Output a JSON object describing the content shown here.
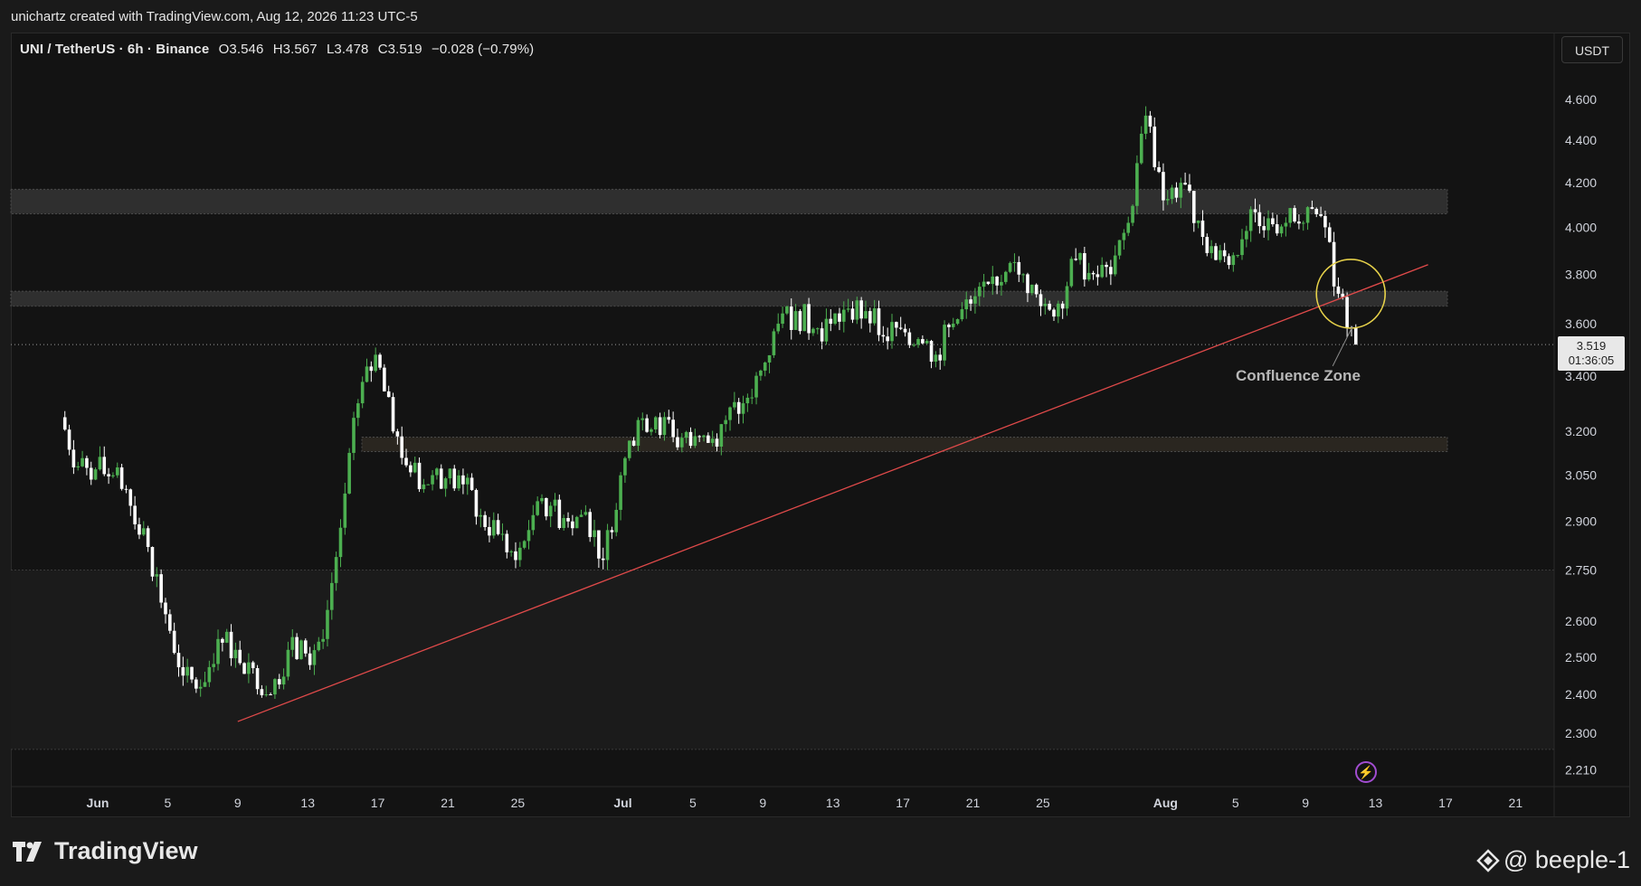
{
  "header": {
    "credit": "unichartz created with TradingView.com, Aug 12, 2026 11:23 UTC-5"
  },
  "legend": {
    "symbol": "UNI / TetherUS · 6h · Binance",
    "open": "O3.546",
    "high": "H3.567",
    "low": "L3.478",
    "close": "C3.519",
    "change": "−0.028 (−0.79%)"
  },
  "currency": "USDT",
  "last_price": {
    "price": "3.519",
    "countdown": "01:36:05"
  },
  "annotation": {
    "label": "Confluence Zone"
  },
  "footer": {
    "brand": "TradingView",
    "watermark": "@ beeple-1"
  },
  "colors": {
    "background": "#131313",
    "up": "#4caf50",
    "down": "#ffffff",
    "trendline": "#e04a4a",
    "zone": "#3a3a3a",
    "circle": "#e6d14a"
  },
  "chart_data": {
    "type": "candlestick",
    "title": "UNI / TetherUS · 6h · Binance",
    "y_axis": {
      "ticks": [
        "4.600",
        "4.400",
        "4.200",
        "4.000",
        "3.800",
        "3.600",
        "3.400",
        "3.200",
        "3.050",
        "2.900",
        "2.750",
        "2.600",
        "2.500",
        "2.400",
        "2.300",
        "2.210"
      ],
      "unit": "USDT",
      "scale": "log",
      "range": [
        2.17,
        4.95
      ]
    },
    "x_axis": {
      "ticks": [
        "Jun",
        "5",
        "9",
        "13",
        "17",
        "21",
        "25",
        "Jul",
        "5",
        "9",
        "13",
        "17",
        "21",
        "25",
        "Aug",
        "5",
        "9",
        "13",
        "17",
        "21"
      ]
    },
    "close_series": [
      {
        "x": "May 30",
        "y": 3.25
      },
      {
        "x": "May 31",
        "y": 3.08
      },
      {
        "x": "Jun 1",
        "y": 3.07
      },
      {
        "x": "Jun 2",
        "y": 3.05
      },
      {
        "x": "Jun 3",
        "y": 2.95
      },
      {
        "x": "Jun 4",
        "y": 2.82
      },
      {
        "x": "Jun 5",
        "y": 2.62
      },
      {
        "x": "Jun 6",
        "y": 2.45
      },
      {
        "x": "Jun 7",
        "y": 2.42
      },
      {
        "x": "Jun 8",
        "y": 2.55
      },
      {
        "x": "Jun 9",
        "y": 2.52
      },
      {
        "x": "Jun 10",
        "y": 2.47
      },
      {
        "x": "Jun 11",
        "y": 2.4
      },
      {
        "x": "Jun 12",
        "y": 2.52
      },
      {
        "x": "Jun 13",
        "y": 2.51
      },
      {
        "x": "Jun 14",
        "y": 2.55
      },
      {
        "x": "Jun 15",
        "y": 2.88
      },
      {
        "x": "Jun 16",
        "y": 3.3
      },
      {
        "x": "Jun 17",
        "y": 3.48
      },
      {
        "x": "Jun 18",
        "y": 3.2
      },
      {
        "x": "Jun 19",
        "y": 3.06
      },
      {
        "x": "Jun 20",
        "y": 3.02
      },
      {
        "x": "Jun 21",
        "y": 3.04
      },
      {
        "x": "Jun 22",
        "y": 3.02
      },
      {
        "x": "Jun 23",
        "y": 2.92
      },
      {
        "x": "Jun 24",
        "y": 2.86
      },
      {
        "x": "Jun 25",
        "y": 2.78
      },
      {
        "x": "Jun 26",
        "y": 2.92
      },
      {
        "x": "Jun 27",
        "y": 2.95
      },
      {
        "x": "Jun 28",
        "y": 2.9
      },
      {
        "x": "Jun 29",
        "y": 2.93
      },
      {
        "x": "Jun 30",
        "y": 2.78
      },
      {
        "x": "Jul 1",
        "y": 3.05
      },
      {
        "x": "Jul 2",
        "y": 3.24
      },
      {
        "x": "Jul 3",
        "y": 3.25
      },
      {
        "x": "Jul 4",
        "y": 3.18
      },
      {
        "x": "Jul 5",
        "y": 3.15
      },
      {
        "x": "Jul 6",
        "y": 3.16
      },
      {
        "x": "Jul 7",
        "y": 3.24
      },
      {
        "x": "Jul 8",
        "y": 3.3
      },
      {
        "x": "Jul 9",
        "y": 3.42
      },
      {
        "x": "Jul 10",
        "y": 3.6
      },
      {
        "x": "Jul 11",
        "y": 3.65
      },
      {
        "x": "Jul 12",
        "y": 3.58
      },
      {
        "x": "Jul 13",
        "y": 3.6
      },
      {
        "x": "Jul 14",
        "y": 3.66
      },
      {
        "x": "Jul 15",
        "y": 3.65
      },
      {
        "x": "Jul 16",
        "y": 3.55
      },
      {
        "x": "Jul 17",
        "y": 3.58
      },
      {
        "x": "Jul 18",
        "y": 3.54
      },
      {
        "x": "Jul 19",
        "y": 3.48
      },
      {
        "x": "Jul 20",
        "y": 3.6
      },
      {
        "x": "Jul 21",
        "y": 3.68
      },
      {
        "x": "Jul 22",
        "y": 3.76
      },
      {
        "x": "Jul 23",
        "y": 3.81
      },
      {
        "x": "Jul 24",
        "y": 3.8
      },
      {
        "x": "Jul 25",
        "y": 3.67
      },
      {
        "x": "Jul 26",
        "y": 3.68
      },
      {
        "x": "Jul 27",
        "y": 3.86
      },
      {
        "x": "Jul 28",
        "y": 3.8
      },
      {
        "x": "Jul 29",
        "y": 3.8
      },
      {
        "x": "Jul 30",
        "y": 4.02
      },
      {
        "x": "Jul 31",
        "y": 4.52
      },
      {
        "x": "Aug 1",
        "y": 4.12
      },
      {
        "x": "Aug 2",
        "y": 4.2
      },
      {
        "x": "Aug 3",
        "y": 4.03
      },
      {
        "x": "Aug 4",
        "y": 3.86
      },
      {
        "x": "Aug 5",
        "y": 3.88
      },
      {
        "x": "Aug 6",
        "y": 4.08
      },
      {
        "x": "Aug 7",
        "y": 4.04
      },
      {
        "x": "Aug 8",
        "y": 4.02
      },
      {
        "x": "Aug 9",
        "y": 4.02
      },
      {
        "x": "Aug 10",
        "y": 4.05
      },
      {
        "x": "Aug 11",
        "y": 3.72
      },
      {
        "x": "Aug 12",
        "y": 3.519
      }
    ],
    "zones": [
      {
        "low": 4.06,
        "high": 4.17
      },
      {
        "low": 3.67,
        "high": 3.73
      },
      {
        "low": 3.13,
        "high": 3.18
      }
    ],
    "trendline": {
      "from": {
        "x": "Jun 9",
        "y": 2.33
      },
      "to": {
        "x": "Aug 16",
        "y": 3.84
      }
    },
    "current_price": 3.519,
    "annotations": [
      "Confluence Zone"
    ]
  }
}
